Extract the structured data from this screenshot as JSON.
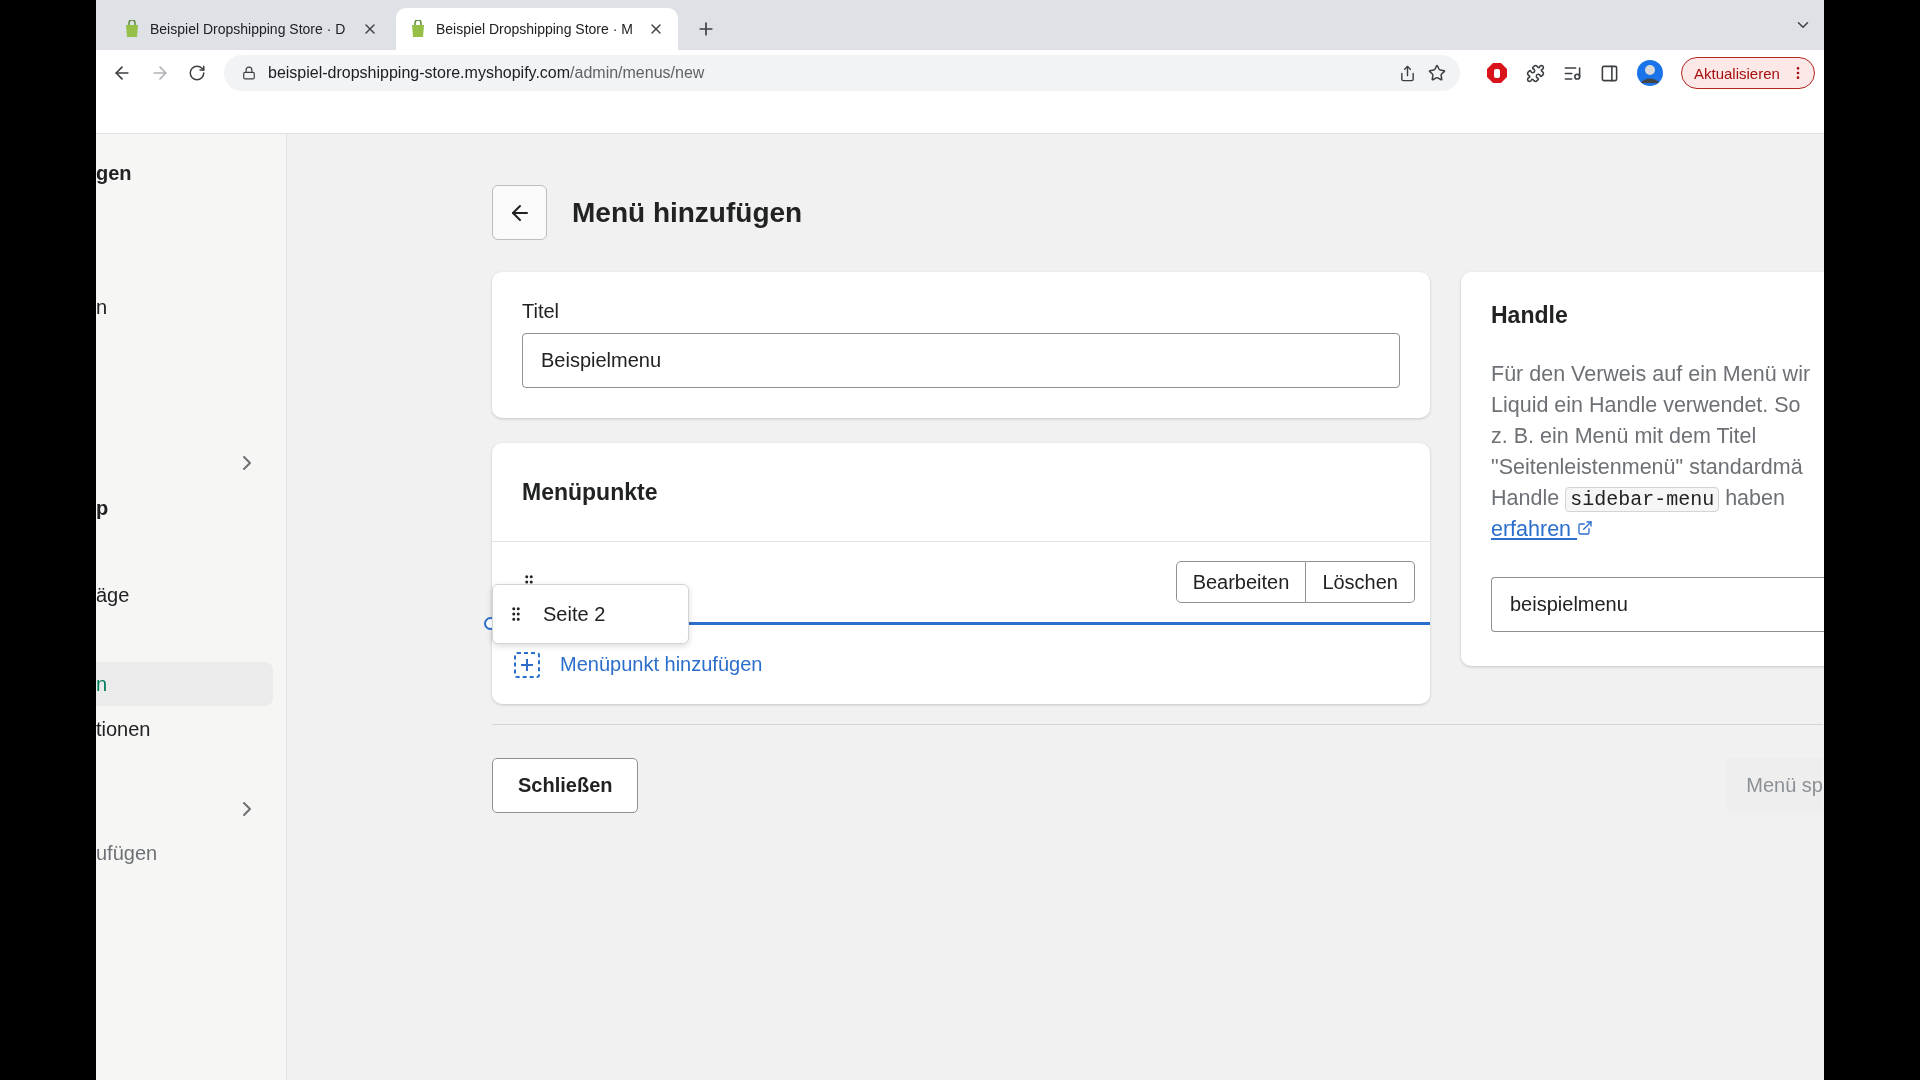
{
  "browser": {
    "tabs": [
      {
        "title": "Beispiel Dropshipping Store · D",
        "selected": false
      },
      {
        "title": "Beispiel Dropshipping Store · M",
        "selected": true
      }
    ],
    "url_host": "beispiel-dropshipping-store.myshopify.com",
    "url_path": "/admin/menus/new",
    "update_button": "Aktualisieren"
  },
  "sidebar": {
    "items": [
      {
        "kind": "heading",
        "label": "gen",
        "selected": false
      },
      {
        "kind": "item",
        "label": "n",
        "selected": false
      },
      {
        "kind": "expander"
      },
      {
        "kind": "heading",
        "label": "p",
        "selected": false
      },
      {
        "kind": "item",
        "label": "äge",
        "selected": false
      },
      {
        "kind": "item",
        "label": "n",
        "selected": true
      },
      {
        "kind": "item",
        "label": "tionen",
        "selected": false
      },
      {
        "kind": "expander"
      },
      {
        "kind": "muted",
        "label": "ufügen",
        "selected": false
      }
    ]
  },
  "page": {
    "title": "Menü hinzufügen"
  },
  "title_card": {
    "label": "Titel",
    "value": "Beispielmenu"
  },
  "menu_items": {
    "heading": "Menüpunkte",
    "items": [
      {
        "actions": [
          "Bearbeiten",
          "Löschen"
        ]
      }
    ],
    "dragged": {
      "label": "Seite 2"
    },
    "add_label": "Menüpunkt hinzufügen"
  },
  "handle": {
    "heading": "Handle",
    "description_lines": [
      "Für den Verweis auf ein Menü wir",
      "Liquid ein Handle verwendet. So",
      "z. B. ein Menü mit dem Titel",
      "\"Seitenleistenmenü\" standardmä",
      "Handle"
    ],
    "code": "sidebar-menu",
    "after_code": "haben",
    "link": "erfahren",
    "value": "beispielmenu"
  },
  "footer": {
    "close_button": "Schließen",
    "save_button": "Menü sp",
    "save_disabled": true
  }
}
